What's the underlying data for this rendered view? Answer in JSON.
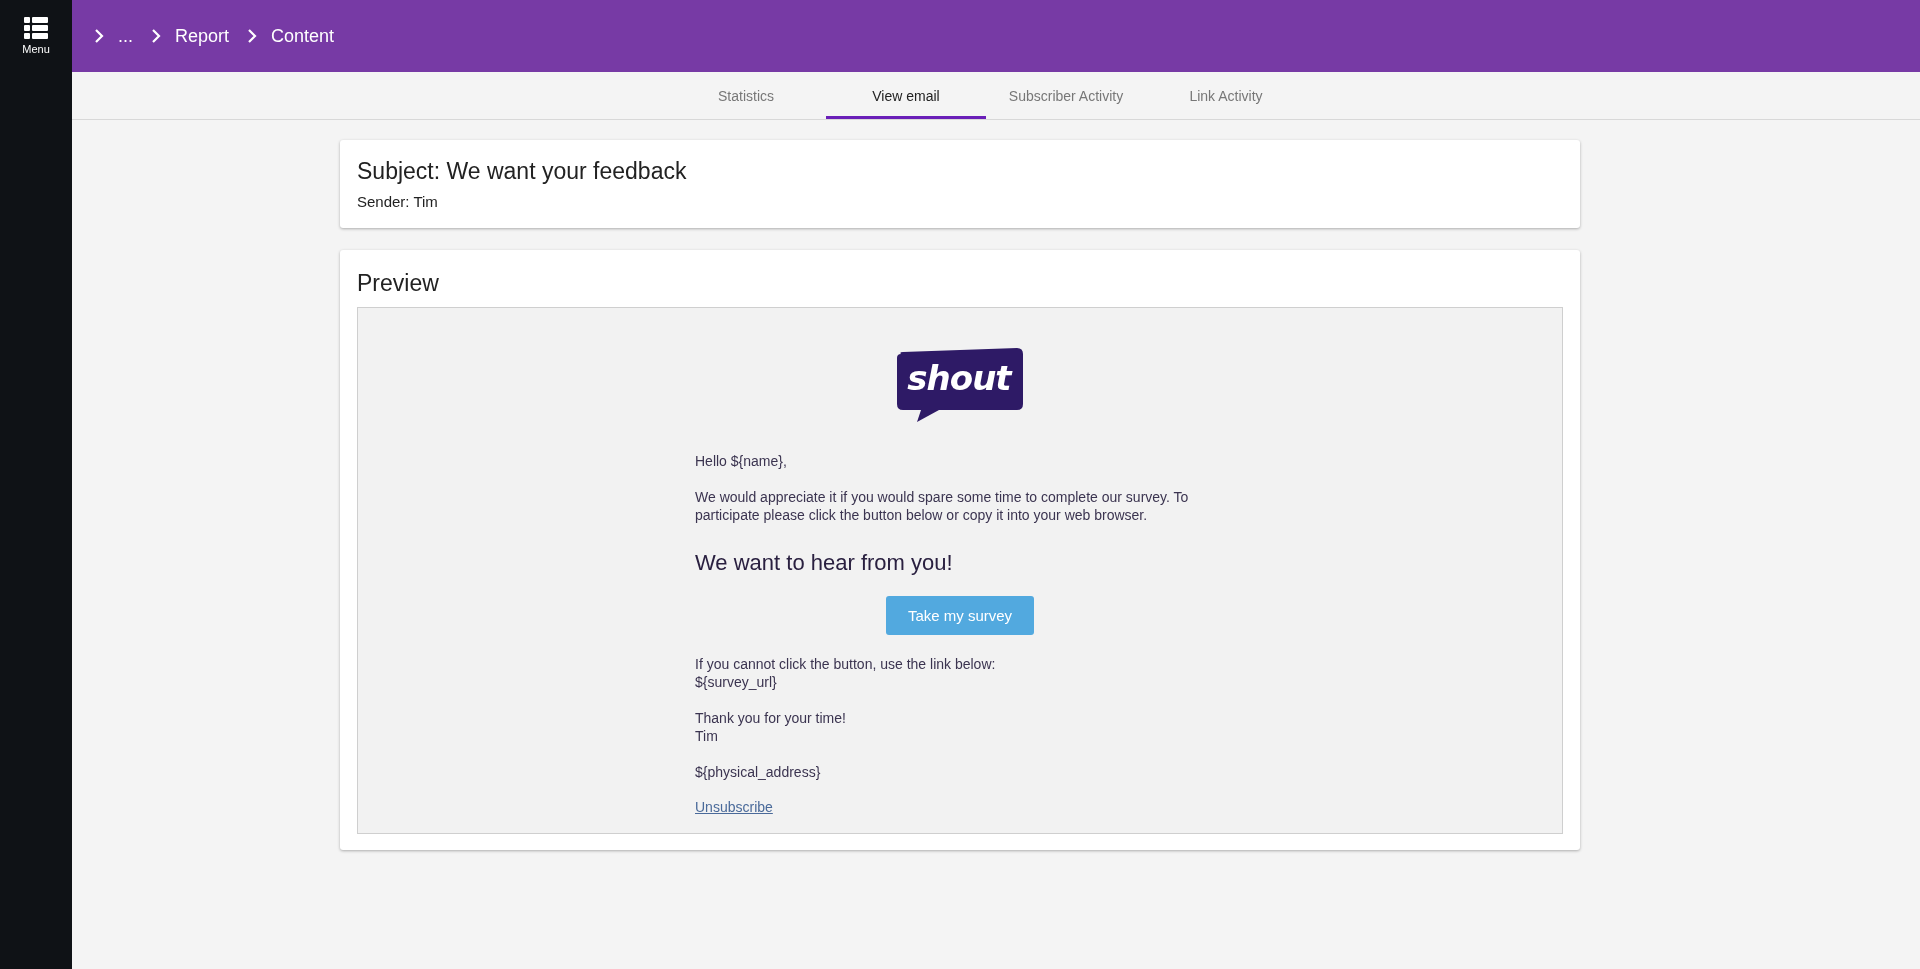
{
  "sidebar": {
    "menu_label": "Menu"
  },
  "breadcrumb": [
    "...",
    "Report",
    "Content"
  ],
  "tabs": [
    {
      "label": "Statistics",
      "selected": false
    },
    {
      "label": "View email",
      "selected": true
    },
    {
      "label": "Subscriber Activity",
      "selected": false
    },
    {
      "label": "Link Activity",
      "selected": false
    }
  ],
  "subject_card": {
    "subject": "Subject: We want your feedback",
    "sender": "Sender: Tim"
  },
  "preview": {
    "title": "Preview",
    "email": {
      "logo_text": "shout",
      "greeting": "Hello ${name},",
      "body": "We would appreciate it if you would spare some time to complete our survey. To participate please click the button below or copy it into your web browser.",
      "heading": "We want to hear from you!",
      "button": "Take my survey",
      "fallback_lines": [
        "If you cannot click the button, use the link below:",
        "${survey_url}"
      ],
      "signoff_lines": [
        "Thank you for your time!",
        "Tim"
      ],
      "address": "${physical_address}",
      "unsubscribe": "Unsubscribe"
    }
  }
}
